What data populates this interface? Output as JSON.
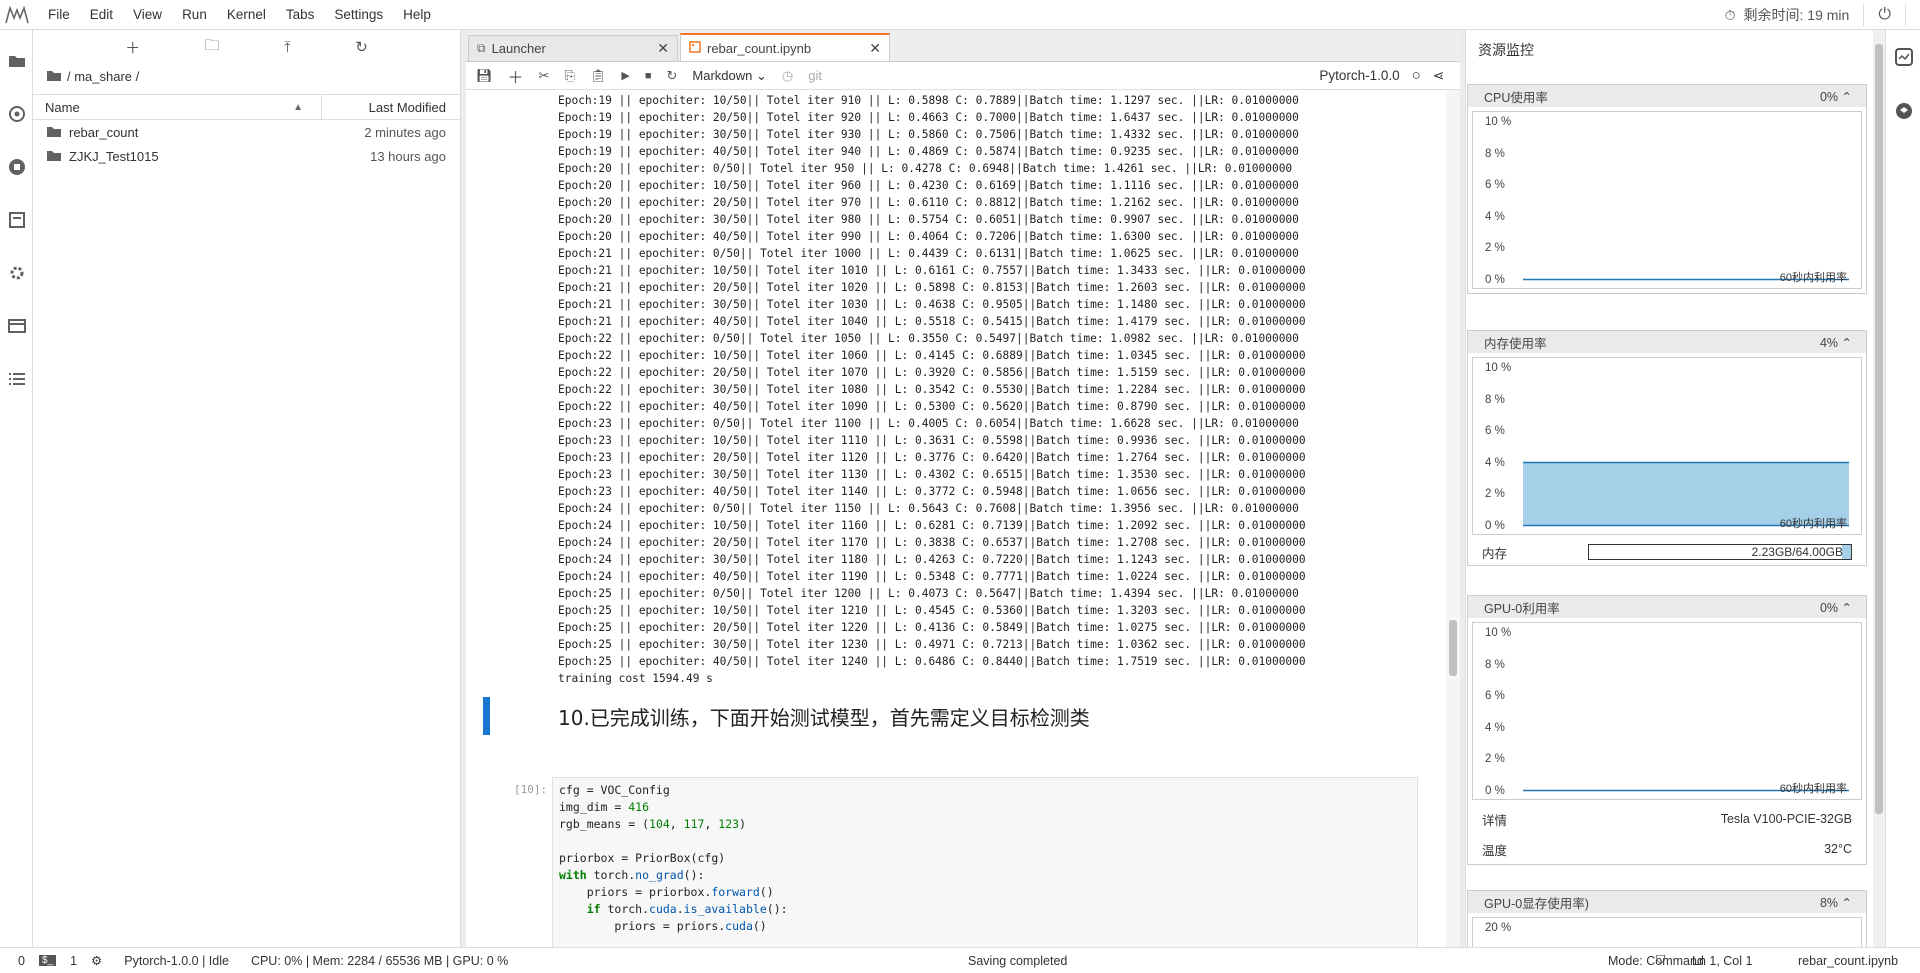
{
  "menu": [
    "File",
    "Edit",
    "View",
    "Run",
    "Kernel",
    "Tabs",
    "Settings",
    "Help"
  ],
  "topright": {
    "remaining": "剩余时间: 19 min"
  },
  "filebrowser": {
    "breadcrumb": "/ ma_share /",
    "col_name": "Name",
    "col_modified": "Last Modified",
    "files": [
      {
        "name": "rebar_count",
        "modified": "2 minutes ago"
      },
      {
        "name": "ZJKJ_Test1015",
        "modified": "13 hours ago"
      }
    ]
  },
  "tabs": [
    {
      "label": "Launcher"
    },
    {
      "label": "rebar_count.ipynb"
    }
  ],
  "notebook_toolbar": {
    "cell_type": "Markdown",
    "git": "git",
    "kernel": "Pytorch-1.0.0"
  },
  "output_lines": [
    "Epoch:19 || epochiter: 10/50|| Totel iter 910 || L: 0.5898 C: 0.7889||Batch time: 1.1297 sec. ||LR: 0.01000000",
    "Epoch:19 || epochiter: 20/50|| Totel iter 920 || L: 0.4663 C: 0.7000||Batch time: 1.6437 sec. ||LR: 0.01000000",
    "Epoch:19 || epochiter: 30/50|| Totel iter 930 || L: 0.5860 C: 0.7506||Batch time: 1.4332 sec. ||LR: 0.01000000",
    "Epoch:19 || epochiter: 40/50|| Totel iter 940 || L: 0.4869 C: 0.5874||Batch time: 0.9235 sec. ||LR: 0.01000000",
    "Epoch:20 || epochiter: 0/50|| Totel iter 950 || L: 0.4278 C: 0.6948||Batch time: 1.4261 sec. ||LR: 0.01000000",
    "Epoch:20 || epochiter: 10/50|| Totel iter 960 || L: 0.4230 C: 0.6169||Batch time: 1.1116 sec. ||LR: 0.01000000",
    "Epoch:20 || epochiter: 20/50|| Totel iter 970 || L: 0.6110 C: 0.8812||Batch time: 1.2162 sec. ||LR: 0.01000000",
    "Epoch:20 || epochiter: 30/50|| Totel iter 980 || L: 0.5754 C: 0.6051||Batch time: 0.9907 sec. ||LR: 0.01000000",
    "Epoch:20 || epochiter: 40/50|| Totel iter 990 || L: 0.4064 C: 0.7206||Batch time: 1.6300 sec. ||LR: 0.01000000",
    "Epoch:21 || epochiter: 0/50|| Totel iter 1000 || L: 0.4439 C: 0.6131||Batch time: 1.0625 sec. ||LR: 0.01000000",
    "Epoch:21 || epochiter: 10/50|| Totel iter 1010 || L: 0.6161 C: 0.7557||Batch time: 1.3433 sec. ||LR: 0.01000000",
    "Epoch:21 || epochiter: 20/50|| Totel iter 1020 || L: 0.5898 C: 0.8153||Batch time: 1.2603 sec. ||LR: 0.01000000",
    "Epoch:21 || epochiter: 30/50|| Totel iter 1030 || L: 0.4638 C: 0.9505||Batch time: 1.1480 sec. ||LR: 0.01000000",
    "Epoch:21 || epochiter: 40/50|| Totel iter 1040 || L: 0.5518 C: 0.5415||Batch time: 1.4179 sec. ||LR: 0.01000000",
    "Epoch:22 || epochiter: 0/50|| Totel iter 1050 || L: 0.3550 C: 0.5497||Batch time: 1.0982 sec. ||LR: 0.01000000",
    "Epoch:22 || epochiter: 10/50|| Totel iter 1060 || L: 0.4145 C: 0.6889||Batch time: 1.0345 sec. ||LR: 0.01000000",
    "Epoch:22 || epochiter: 20/50|| Totel iter 1070 || L: 0.3920 C: 0.5856||Batch time: 1.5159 sec. ||LR: 0.01000000",
    "Epoch:22 || epochiter: 30/50|| Totel iter 1080 || L: 0.3542 C: 0.5530||Batch time: 1.2284 sec. ||LR: 0.01000000",
    "Epoch:22 || epochiter: 40/50|| Totel iter 1090 || L: 0.5300 C: 0.5620||Batch time: 0.8790 sec. ||LR: 0.01000000",
    "Epoch:23 || epochiter: 0/50|| Totel iter 1100 || L: 0.4005 C: 0.6054||Batch time: 1.6628 sec. ||LR: 0.01000000",
    "Epoch:23 || epochiter: 10/50|| Totel iter 1110 || L: 0.3631 C: 0.5598||Batch time: 0.9936 sec. ||LR: 0.01000000",
    "Epoch:23 || epochiter: 20/50|| Totel iter 1120 || L: 0.3776 C: 0.6420||Batch time: 1.2764 sec. ||LR: 0.01000000",
    "Epoch:23 || epochiter: 30/50|| Totel iter 1130 || L: 0.4302 C: 0.6515||Batch time: 1.3530 sec. ||LR: 0.01000000",
    "Epoch:23 || epochiter: 40/50|| Totel iter 1140 || L: 0.3772 C: 0.5948||Batch time: 1.0656 sec. ||LR: 0.01000000",
    "Epoch:24 || epochiter: 0/50|| Totel iter 1150 || L: 0.5643 C: 0.7608||Batch time: 1.3956 sec. ||LR: 0.01000000",
    "Epoch:24 || epochiter: 10/50|| Totel iter 1160 || L: 0.6281 C: 0.7139||Batch time: 1.2092 sec. ||LR: 0.01000000",
    "Epoch:24 || epochiter: 20/50|| Totel iter 1170 || L: 0.3838 C: 0.6537||Batch time: 1.2708 sec. ||LR: 0.01000000",
    "Epoch:24 || epochiter: 30/50|| Totel iter 1180 || L: 0.4263 C: 0.7220||Batch time: 1.1243 sec. ||LR: 0.01000000",
    "Epoch:24 || epochiter: 40/50|| Totel iter 1190 || L: 0.5348 C: 0.7771||Batch time: 1.0224 sec. ||LR: 0.01000000",
    "Epoch:25 || epochiter: 0/50|| Totel iter 1200 || L: 0.4073 C: 0.5647||Batch time: 1.4394 sec. ||LR: 0.01000000",
    "Epoch:25 || epochiter: 10/50|| Totel iter 1210 || L: 0.4545 C: 0.5360||Batch time: 1.3203 sec. ||LR: 0.01000000",
    "Epoch:25 || epochiter: 20/50|| Totel iter 1220 || L: 0.4136 C: 0.5849||Batch time: 1.0275 sec. ||LR: 0.01000000",
    "Epoch:25 || epochiter: 30/50|| Totel iter 1230 || L: 0.4971 C: 0.7213||Batch time: 1.0362 sec. ||LR: 0.01000000",
    "Epoch:25 || epochiter: 40/50|| Totel iter 1240 || L: 0.6486 C: 0.8440||Batch time: 1.7519 sec. ||LR: 0.01000000",
    "training cost 1594.49 s"
  ],
  "markdown_heading": "10.已完成训练，下面开始测试模型，首先需定义目标检测类",
  "code_prompt": "[10]:",
  "resource_monitor": {
    "title": "资源监控",
    "cpu": {
      "label": "CPU使用率",
      "value": "0%",
      "ticks": [
        "10 %",
        "8 %",
        "6 %",
        "4 %",
        "2 %",
        "0 %"
      ],
      "footer": "60秒内利用率",
      "level": 0
    },
    "mem": {
      "label": "内存使用率",
      "value": "4%",
      "ticks": [
        "10 %",
        "8 %",
        "6 %",
        "4 %",
        "2 %",
        "0 %"
      ],
      "footer": "60秒内利用率",
      "level": 0.4,
      "bar_label": "内存",
      "bar_text": "2.23GB/64.00GB",
      "bar_fill": 0.035
    },
    "gpu": {
      "label": "GPU-0利用率",
      "value": "0%",
      "ticks": [
        "10 %",
        "8 %",
        "6 %",
        "4 %",
        "2 %",
        "0 %"
      ],
      "footer": "60秒内利用率",
      "level": 0,
      "detail_label": "详情",
      "detail_value": "Tesla V100-PCIE-32GB",
      "temp_label": "温度",
      "temp_value": "32°C"
    },
    "gpumem": {
      "label": "GPU-0显存使用率)",
      "value": "8%",
      "tick": "20 %"
    }
  },
  "status": {
    "num0": "0",
    "num1": "1",
    "kernel": "Pytorch-1.0.0 | Idle",
    "usage": "CPU: 0% | Mem: 2284 / 65536 MB | GPU: 0 %",
    "saving": "Saving completed",
    "mode": "Mode: Command",
    "position": "Ln 1, Col 1",
    "file": "rebar_count.ipynb"
  },
  "colors": {
    "accent": "#f37626",
    "cell_active": "#1976d2",
    "mem_fill": "#a6cfe8"
  }
}
